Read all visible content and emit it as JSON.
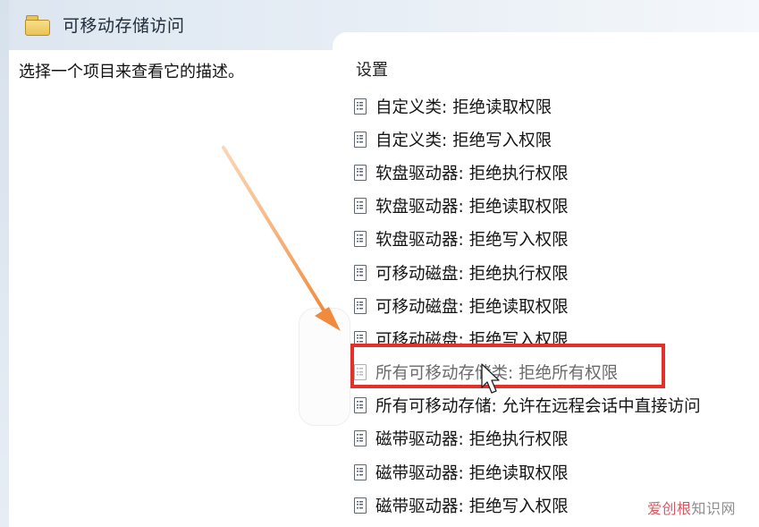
{
  "window": {
    "title": "可移动存储访问",
    "icon": "folder-icon"
  },
  "left_panel": {
    "description": "选择一个项目来查看它的描述。"
  },
  "settings": {
    "header": "设置",
    "items": [
      {
        "label": "自定义类: 拒绝读取权限"
      },
      {
        "label": "自定义类: 拒绝写入权限"
      },
      {
        "label": "软盘驱动器: 拒绝执行权限"
      },
      {
        "label": "软盘驱动器: 拒绝读取权限"
      },
      {
        "label": "软盘驱动器: 拒绝写入权限"
      },
      {
        "label": "可移动磁盘: 拒绝执行权限"
      },
      {
        "label": "可移动磁盘: 拒绝读取权限"
      },
      {
        "label": "可移动磁盘: 拒绝写入权限"
      },
      {
        "label": "所有可移动存储类: 拒绝所有权限",
        "highlighted": true
      },
      {
        "label": "所有可移动存储: 允许在远程会话中直接访问"
      },
      {
        "label": "磁带驱动器: 拒绝执行权限"
      },
      {
        "label": "磁带驱动器: 拒绝读取权限"
      },
      {
        "label": "磁带驱动器: 拒绝写入权限"
      }
    ]
  },
  "annotations": {
    "highlight_color": "#e2302b",
    "arrow_color": "#f08a3c"
  },
  "watermark": {
    "text_accent": "爱创根",
    "text_rest": "知识网"
  }
}
